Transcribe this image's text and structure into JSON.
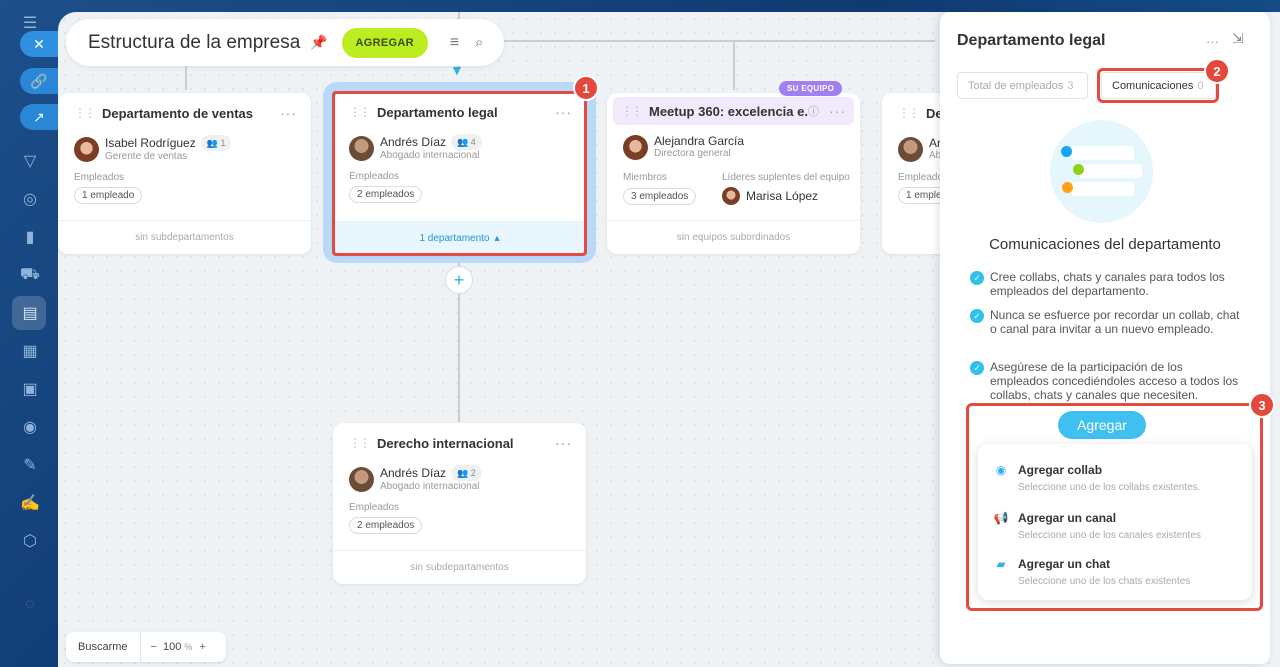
{
  "header": {
    "title": "Estructura de la empresa",
    "add_label": "AGREGAR"
  },
  "cards": {
    "ventas": {
      "title": "Departamento de ventas",
      "head_name": "Isabel Rodríguez",
      "head_count": "1",
      "head_role": "Gerente de ventas",
      "employees_label": "Empleados",
      "employees_chip": "1 empleado",
      "footer": "sin subdepartamentos"
    },
    "legal": {
      "title": "Departamento legal",
      "head_name": "Andrés Díaz",
      "head_count": "4",
      "head_role": "Abogado internacional",
      "employees_label": "Empleados",
      "employees_chip": "2 empleados",
      "footer": "1 departamento"
    },
    "meetup": {
      "badge": "SU EQUIPO",
      "title": "Meetup 360: excelencia e...",
      "head_name": "Alejandra García",
      "head_role": "Directora general",
      "members_label": "Miembros",
      "members_chip": "3 empleados",
      "deputies_label": "Líderes suplentes del equipo",
      "deputy_name": "Marisa López",
      "footer": "sin equipos subordinados"
    },
    "partial": {
      "title": "Dep",
      "head_name": "An",
      "head_role": "Ab",
      "employees_label": "Empleado",
      "employees_chip": "1 emple"
    },
    "derecho": {
      "title": "Derecho internacional",
      "head_name": "Andrés Díaz",
      "head_count": "2",
      "head_role": "Abogado internacional",
      "employees_label": "Empleados",
      "employees_chip": "2 empleados",
      "footer": "sin subdepartamentos"
    }
  },
  "annotations": [
    "1",
    "2",
    "3"
  ],
  "zoom": {
    "find_me": "Buscarme",
    "minus": "−",
    "value": "100",
    "unit": "%",
    "plus": "+"
  },
  "panel": {
    "title": "Departamento legal",
    "tabs": [
      {
        "label": "Total de empleados",
        "count": "3"
      },
      {
        "label": "Comunicaciones",
        "count": "0"
      }
    ],
    "heading": "Comunicaciones del departamento",
    "features": [
      "Cree collabs, chats y canales para todos los empleados del departamento.",
      "Nunca se esfuerce por recordar un collab, chat o canal para invitar a un nuevo empleado.",
      "Asegúrese de la participación de los empleados concediéndoles acceso a todos los collabs, chats y canales que necesiten."
    ],
    "add_button": "Agregar",
    "menu": [
      {
        "title": "Agregar collab",
        "subtitle": "Seleccione uno de los collabs existentes."
      },
      {
        "title": "Agregar un canal",
        "subtitle": "Seleccione uno de los canales existentes"
      },
      {
        "title": "Agregar un chat",
        "subtitle": "Seleccione uno de los chats existentes"
      }
    ]
  },
  "colors": {
    "accent_green": "#bbed21",
    "accent_blue": "#3fc0f0",
    "highlight_red": "#e44a3f",
    "team_purple": "#a27ff0"
  }
}
